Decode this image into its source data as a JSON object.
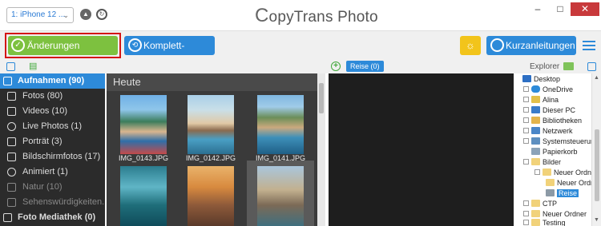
{
  "titlebar": {
    "device": "1: iPhone 12 ...",
    "app_title_first": "C",
    "app_title_rest": "opyTrans Photo",
    "minimize": "–",
    "maximize": "□",
    "close": "✕"
  },
  "toolbar": {
    "save_label": "Änderungen speichern",
    "backup_label": "Komplett-Backup",
    "guides_label": "Kurzanleitungen"
  },
  "subhead": {
    "album_tab": "Reise (0)",
    "explorer_label": "Explorer"
  },
  "sidebar": {
    "items": [
      {
        "label": "Aufnahmen (90)",
        "icon": "camera-roll-icon"
      },
      {
        "label": "Fotos (80)",
        "icon": "camera-icon"
      },
      {
        "label": "Videos (10)",
        "icon": "video-icon"
      },
      {
        "label": "Live Photos (1)",
        "icon": "live-photo-icon"
      },
      {
        "label": "Porträt (3)",
        "icon": "portrait-cube-icon"
      },
      {
        "label": "Bildschirmfotos (17)",
        "icon": "screenshot-icon"
      },
      {
        "label": "Animiert (1)",
        "icon": "animated-icon"
      },
      {
        "label": "Natur (10)",
        "icon": "album-icon"
      },
      {
        "label": "Sehenswürdigkeiten...",
        "icon": "album-icon"
      },
      {
        "label": "Foto Mediathek (0)",
        "icon": "library-icon"
      }
    ]
  },
  "gallery": {
    "heading": "Heute",
    "thumbs": [
      {
        "caption": "IMG_0143.JPG"
      },
      {
        "caption": "IMG_0142.JPG"
      },
      {
        "caption": "IMG_0141.JPG"
      },
      {
        "caption": ""
      },
      {
        "caption": ""
      },
      {
        "caption": ""
      }
    ]
  },
  "tree": {
    "items": [
      {
        "label": "Desktop"
      },
      {
        "label": "OneDrive"
      },
      {
        "label": "Alina"
      },
      {
        "label": "Dieser PC"
      },
      {
        "label": "Bibliotheken"
      },
      {
        "label": "Netzwerk"
      },
      {
        "label": "Systemsteuerung"
      },
      {
        "label": "Papierkorb"
      },
      {
        "label": "Bilder"
      },
      {
        "label": "Neuer Ordner"
      },
      {
        "label": "Neuer Ordner"
      },
      {
        "label": "Reise"
      },
      {
        "label": "CTP"
      },
      {
        "label": "Neuer Ordner"
      },
      {
        "label": "Testing"
      }
    ]
  },
  "colors": {
    "accent_blue": "#2d8ad9",
    "save_green": "#7dc13f",
    "highlight_red": "#d41515",
    "bulb_yellow": "#f2c41b"
  }
}
